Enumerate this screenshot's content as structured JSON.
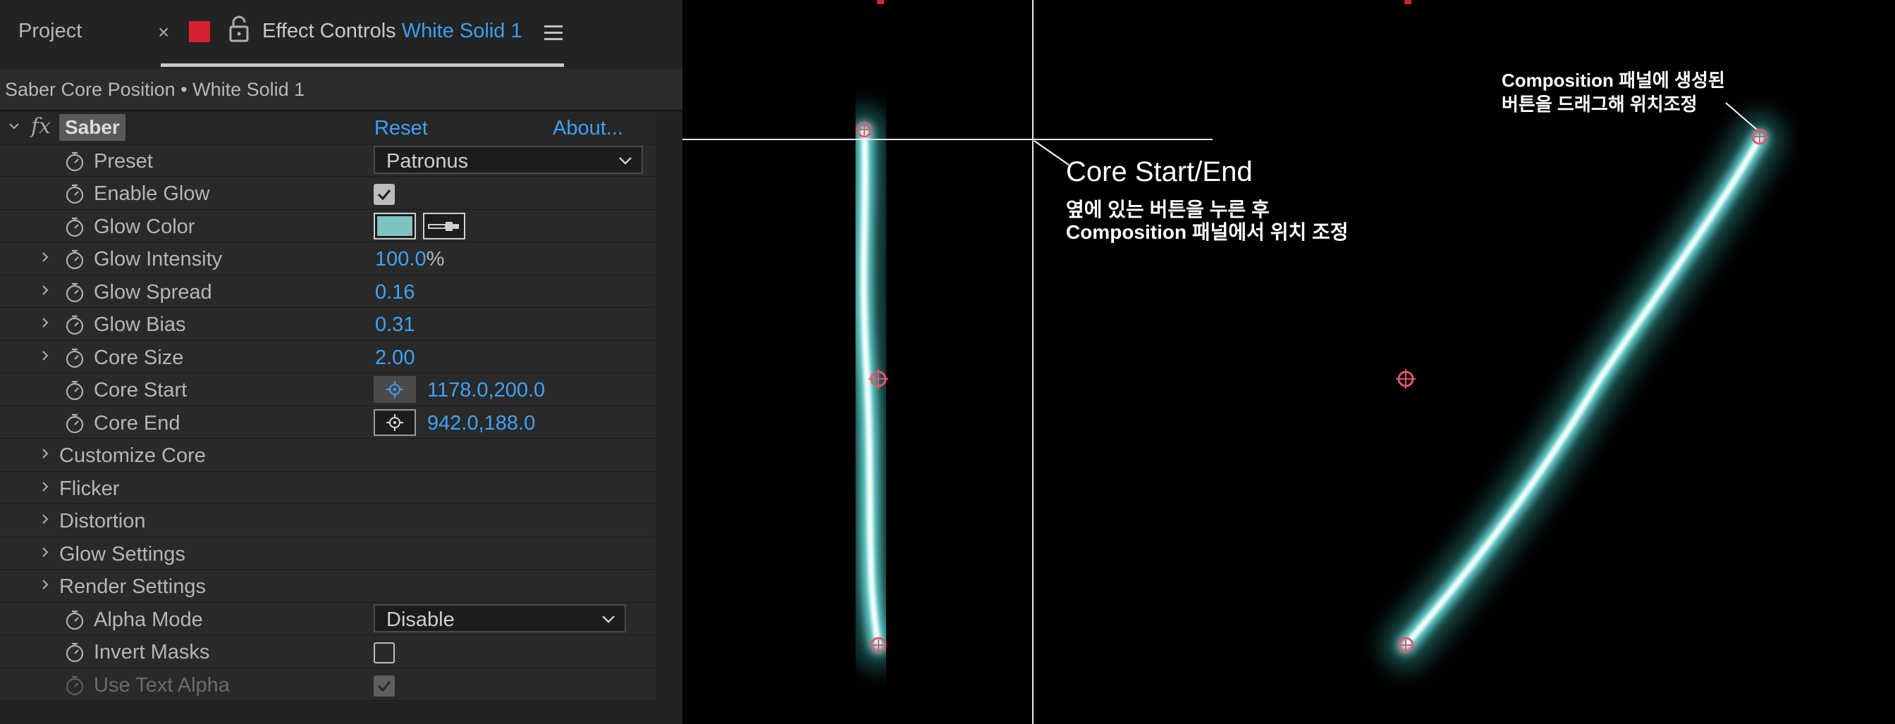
{
  "tabs": {
    "project_label": "Project",
    "close_glyph": "×",
    "effect_controls_label": "Effect Controls",
    "layer_name": "White Solid 1",
    "label_color": "#d52232"
  },
  "subheader": {
    "title": "Saber Core Position • White Solid 1"
  },
  "effect": {
    "fx_glyph": "fx",
    "name": "Saber",
    "reset_label": "Reset",
    "about_label": "About..."
  },
  "params": {
    "preset": {
      "label": "Preset",
      "value": "Patronus"
    },
    "enable_glow": {
      "label": "Enable Glow",
      "checked": true
    },
    "glow_color": {
      "label": "Glow Color",
      "color": "#7dc3c0"
    },
    "glow_intensity": {
      "label": "Glow Intensity",
      "value": "100.0",
      "unit": "%"
    },
    "glow_spread": {
      "label": "Glow Spread",
      "value": "0.16"
    },
    "glow_bias": {
      "label": "Glow Bias",
      "value": "0.31"
    },
    "core_size": {
      "label": "Core Size",
      "value": "2.00"
    },
    "core_start": {
      "label": "Core Start",
      "value": "1178.0,200.0"
    },
    "core_end": {
      "label": "Core End",
      "value": "942.0,188.0"
    },
    "alpha_mode": {
      "label": "Alpha Mode",
      "value": "Disable"
    },
    "invert_masks": {
      "label": "Invert Masks",
      "checked": false
    },
    "use_text_alpha": {
      "label": "Use Text Alpha",
      "checked": true,
      "disabled": true
    }
  },
  "groups": {
    "customize_core": "Customize Core",
    "flicker": "Flicker",
    "distortion": "Distortion",
    "glow_settings": "Glow Settings",
    "render_settings": "Render Settings"
  },
  "annotations": {
    "core_title": "Core Start/End",
    "core_line2": "옆에 있는 버튼을 누른 후",
    "core_line3": "Composition 패널에서 위치 조정",
    "drag_line1": "Composition 패널에 생성된",
    "drag_line2": "버튼을 드래그해 위치조정"
  },
  "colors": {
    "accent_blue": "#3ea3f7",
    "saber_glow": "#7fe6e2",
    "handle_red": "#e0586a"
  },
  "icons": [
    "close-icon",
    "lock-icon",
    "menu-icon",
    "stopwatch-icon",
    "chevron-down-icon",
    "twirl-arrow-icon",
    "eyedropper-icon",
    "point-target-icon",
    "crosshair-handle-icon"
  ]
}
